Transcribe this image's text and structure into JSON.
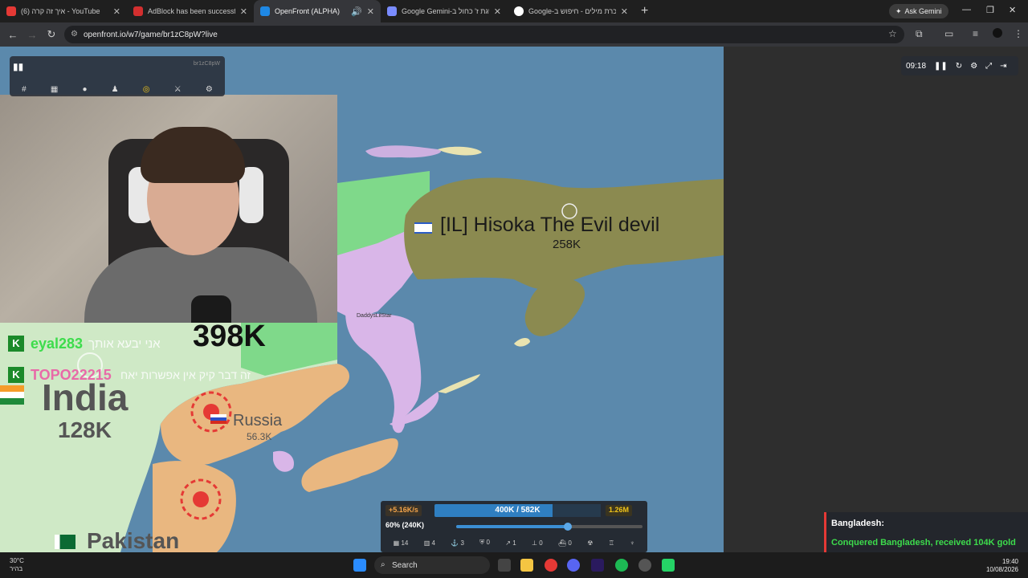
{
  "browser": {
    "tabs": [
      {
        "label": "(6) איך זה קרה - YouTube",
        "color": "#e53935"
      },
      {
        "label": "AdBlock has been successfully ...",
        "color": "#d32f2f"
      },
      {
        "label": "OpenFront (ALPHA)",
        "color": "#1e88e5",
        "active": true
      },
      {
        "label": "Google Gemini-השגת ז' כחול ב",
        "color": "#7a8cff"
      },
      {
        "label": "Google-זיכרת מילים - חיפוש ב",
        "color": "#ffffff"
      }
    ],
    "new_tab": "+",
    "ask_gemini": "Ask Gemini",
    "url": "openfront.io/w7/game/br1zC8pW?live"
  },
  "game": {
    "lobby_id": "br1zC8pW",
    "timer": "09:18",
    "players": [
      {
        "name": "[IL] Hisoka The Evil devil",
        "troops": "258K"
      },
      {
        "name": "India",
        "troops": "128K"
      },
      {
        "name": "Russia",
        "troops": "56.3K"
      },
      {
        "name": "Pakistan",
        "troops": ""
      },
      {
        "name": "eyal283",
        "troops": ""
      },
      {
        "name": "TOPO22215",
        "troops": ""
      },
      {
        "name": "DaddysLilStar",
        "troops": ""
      }
    ],
    "big_troops": "398K",
    "hebrew_line1": "אני יבעא אותך",
    "hebrew_line2": "זה דבר קיק אין אפשרות יאח",
    "controls": {
      "rate": "+5.16K/s",
      "troops": "400K / 582K",
      "gold": "1.26M",
      "attack_ratio": "60% (240K)",
      "attack_ratio_value": 0.6,
      "units": [
        "14",
        "4",
        "3",
        "0",
        "1",
        "0",
        "0"
      ]
    }
  },
  "notification": {
    "title": "Bangladesh:",
    "message": "Conquered Bangladesh, received 104K gold"
  },
  "taskbar": {
    "temperature": "30°C",
    "weather_text": "בהיר",
    "search": "Search",
    "time": "19:40",
    "date": "10/08/2026"
  },
  "colors": {
    "ocean": "#5b89ac",
    "player_territory": "#8b8a50",
    "purple_territory": "#d9b6e8",
    "orange_territory": "#e9b780",
    "green_territory": "#7fd98a",
    "notification_green": "#3ddc4c"
  }
}
